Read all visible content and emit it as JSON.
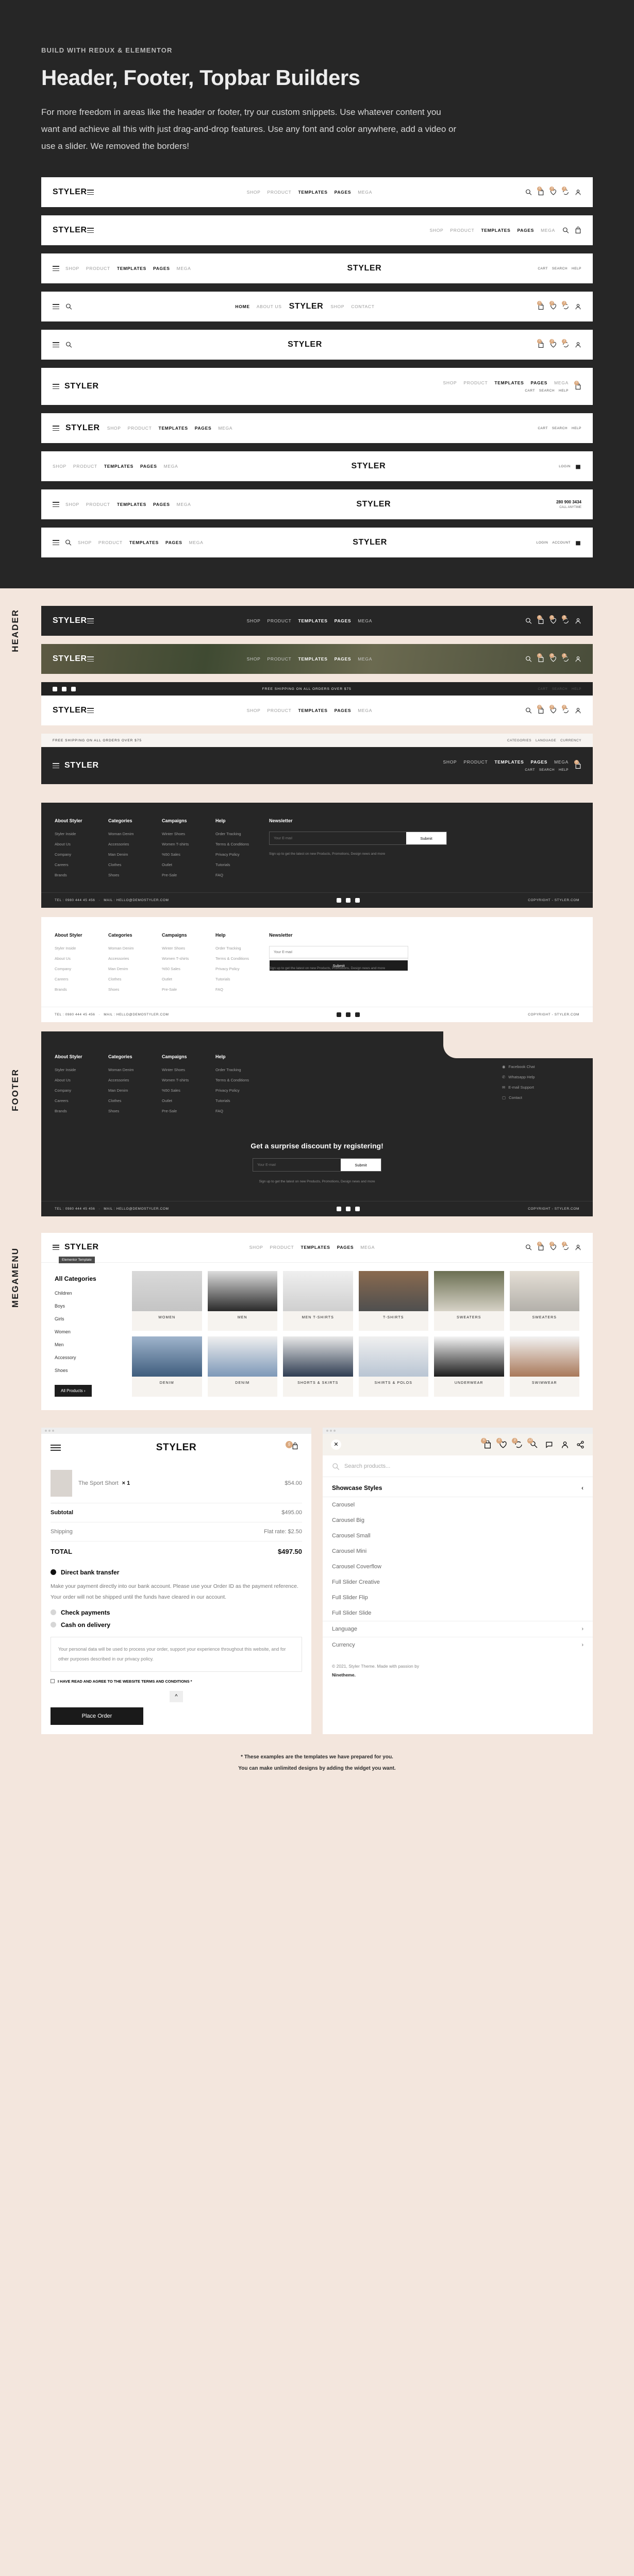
{
  "hero": {
    "kicker": "BUILD WITH REDUX & ELEMENTOR",
    "title": "Header, Footer, Topbar Builders",
    "lede": "For more freedom in areas like the header or footer, try our custom snippets. Use whatever content you want and achieve all this with just drag-and-drop features. Use any font and color anywhere, add a video or use a slider. We removed the borders!"
  },
  "brand": {
    "name": "STYLER"
  },
  "nav": {
    "shop": "SHOP",
    "product": "PRODUCT",
    "templates": "TEMPLATES",
    "pages": "PAGES",
    "mega": "MEGA",
    "home": "HOME",
    "about": "ABOUT US",
    "contact": "CONTACT"
  },
  "mini": {
    "cart": "CART",
    "search": "SEARCH",
    "help": "HELP",
    "login": "LOGIN",
    "account": "ACCOUNT",
    "categories": "CATEGORIES",
    "language": "LANGUAGE",
    "currency": "CURRENCY"
  },
  "phone": {
    "number": "280 900 3434",
    "note": "CALL ANYTIME"
  },
  "shipping": "FREE SHIPPING ON ALL ORDERS OVER $75",
  "labels": {
    "header": "HEADER",
    "footer": "FOOTER",
    "megamenu": "MEGAMENU"
  },
  "badges": {
    "cart": "6",
    "wish": "3",
    "compare": "3",
    "zero": "0"
  },
  "footer": {
    "columns": [
      {
        "title": "About Styler",
        "links": [
          "Styler Inside",
          "About Us",
          "Company",
          "Careers",
          "Brands"
        ]
      },
      {
        "title": "Categories",
        "links": [
          "Woman Denim",
          "Accessories",
          "Man Denim",
          "Clothes",
          "Shoes"
        ]
      },
      {
        "title": "Campaigns",
        "links": [
          "Winter Shoes",
          "Women T-shirts",
          "%50 Sales",
          "Outlet",
          "Pre-Sale"
        ]
      },
      {
        "title": "Help",
        "links": [
          "Order Tracking",
          "Terms & Conditions",
          "Privacy Policy",
          "Tutorials",
          "FAQ"
        ]
      }
    ],
    "newsletter": {
      "title": "Newsletter",
      "placeholder": "Your E-mail",
      "submit": "Submit",
      "note": "Sign up to get the latest on new Products, Promotions, Design news and more"
    },
    "support": {
      "title": "Help",
      "links": [
        "Facebook Chat",
        "Whatsapp Help",
        "E-mail Support",
        "Contact"
      ]
    },
    "discount": {
      "heading": "Get a surprise discount by registering!"
    },
    "bottom": {
      "tel": "TEL : 0980 444 45 456",
      "sep": "·",
      "mail": "MAIL : HELLO@DEMOSTYLER.COM",
      "copyright": "COPYRIGHT - STYLER.COM"
    }
  },
  "megamenu": {
    "tooltip": "Elementor Template",
    "heading": "All Categories",
    "categories": [
      "Children",
      "Boys",
      "Girls",
      "Women",
      "Men",
      "Accessory",
      "Shoes"
    ],
    "all_products": "All Products",
    "tiles": [
      "WOMEN",
      "MEN",
      "MEN T-SHIRTS",
      "T-SHIRTS",
      "SWEATERS",
      "SWEATERS",
      "DENIM",
      "DENIM",
      "SHORTS & SKIRTS",
      "SHIRTS & POLOS",
      "UNDERWEAR",
      "SWIMWEAR"
    ]
  },
  "checkout": {
    "cart_count": "5",
    "item": {
      "name": "The Sport Short",
      "qty": "× 1",
      "price": "$54.00"
    },
    "subtotal_label": "Subtotal",
    "subtotal": "$495.00",
    "shipping_label": "Shipping",
    "shipping": "Flat rate: $2.50",
    "total_label": "TOTAL",
    "total": "$497.50",
    "pay1": "Direct bank transfer",
    "pay1_desc": "Make your payment directly into our bank account. Please use your Order ID as the payment reference. Your order will not be shipped until the funds have cleared in our account.",
    "pay2": "Check payments",
    "pay3": "Cash on delivery",
    "privacy": "Your personal data will be used to process your order, support your experience throughout this website, and for other purposes described in our privacy policy.",
    "agree": "I HAVE READ AND AGREE TO THE WEBSITE TERMS AND CONDITIONS *",
    "place_order": "Place Order",
    "to_top": "^"
  },
  "sidepanel": {
    "badges": {
      "cart": "5",
      "wish": "0",
      "compare": "3",
      "search": "12"
    },
    "search_placeholder": "Search products...",
    "section_title": "Showcase Styles",
    "items": [
      "Carousel",
      "Carousel Big",
      "Carousel Small",
      "Carousel Mini",
      "Carousel Coverflow",
      "Full Slider Creative",
      "Full Slider Flip",
      "Full Slider Slide"
    ],
    "language": "Language",
    "currency": "Currency",
    "copyright": "© 2021, Styler Theme. Made with passion by",
    "author": "Ninetheme."
  },
  "closing": {
    "line1": "* These examples are the templates we have prepared for you.",
    "line2": "You can make unlimited designs by adding the widget you want."
  },
  "colors": {
    "dark": "#262626",
    "cream": "#f3e6dd",
    "accent": "#dba97f"
  }
}
